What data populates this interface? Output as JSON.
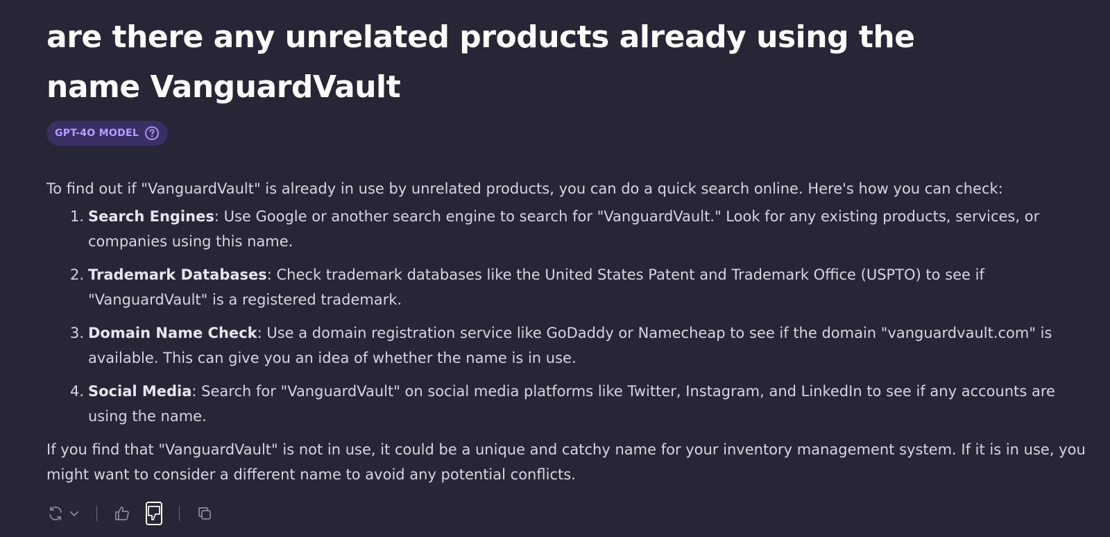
{
  "question": {
    "title": "are there any unrelated products already using the name VanguardVault"
  },
  "model_badge": {
    "label": "GPT-4O MODEL",
    "help_icon": "question-circle-icon"
  },
  "answer": {
    "intro": "To find out if \"VanguardVault\" is already in use by unrelated products, you can do a quick search online. Here's how you can check:",
    "steps": [
      {
        "number": "1.",
        "heading": "Search Engines",
        "text": ": Use Google or another search engine to search for \"VanguardVault.\" Look for any existing products, services, or companies using this name."
      },
      {
        "number": "2.",
        "heading": "Trademark Databases",
        "text": ": Check trademark databases like the United States Patent and Trademark Office (USPTO) to see if \"VanguardVault\" is a registered trademark."
      },
      {
        "number": "3.",
        "heading": "Domain Name Check",
        "text": ": Use a domain registration service like GoDaddy or Namecheap to see if the domain \"vanguardvault.com\" is available. This can give you an idea of whether the name is in use."
      },
      {
        "number": "4.",
        "heading": "Social Media",
        "text": ": Search for \"VanguardVault\" on social media platforms like Twitter, Instagram, and LinkedIn to see if any accounts are using the name."
      }
    ],
    "conclusion": "If you find that \"VanguardVault\" is not in use, it could be a unique and catchy name for your inventory management system. If it is in use, you might want to consider a different name to avoid any potential conflicts."
  },
  "actions": {
    "regenerate_icon": "refresh-icon",
    "dropdown_icon": "chevron-down-icon",
    "like_icon": "thumbs-up-icon",
    "dislike_icon": "thumbs-down-icon",
    "copy_icon": "copy-icon"
  },
  "colors": {
    "background": "#262636",
    "badge_bg": "#3a2f63",
    "badge_text": "#b89cff",
    "body_text": "#d6d6e2",
    "title_text": "#ffffff",
    "icon_muted": "#8a8aa0"
  }
}
